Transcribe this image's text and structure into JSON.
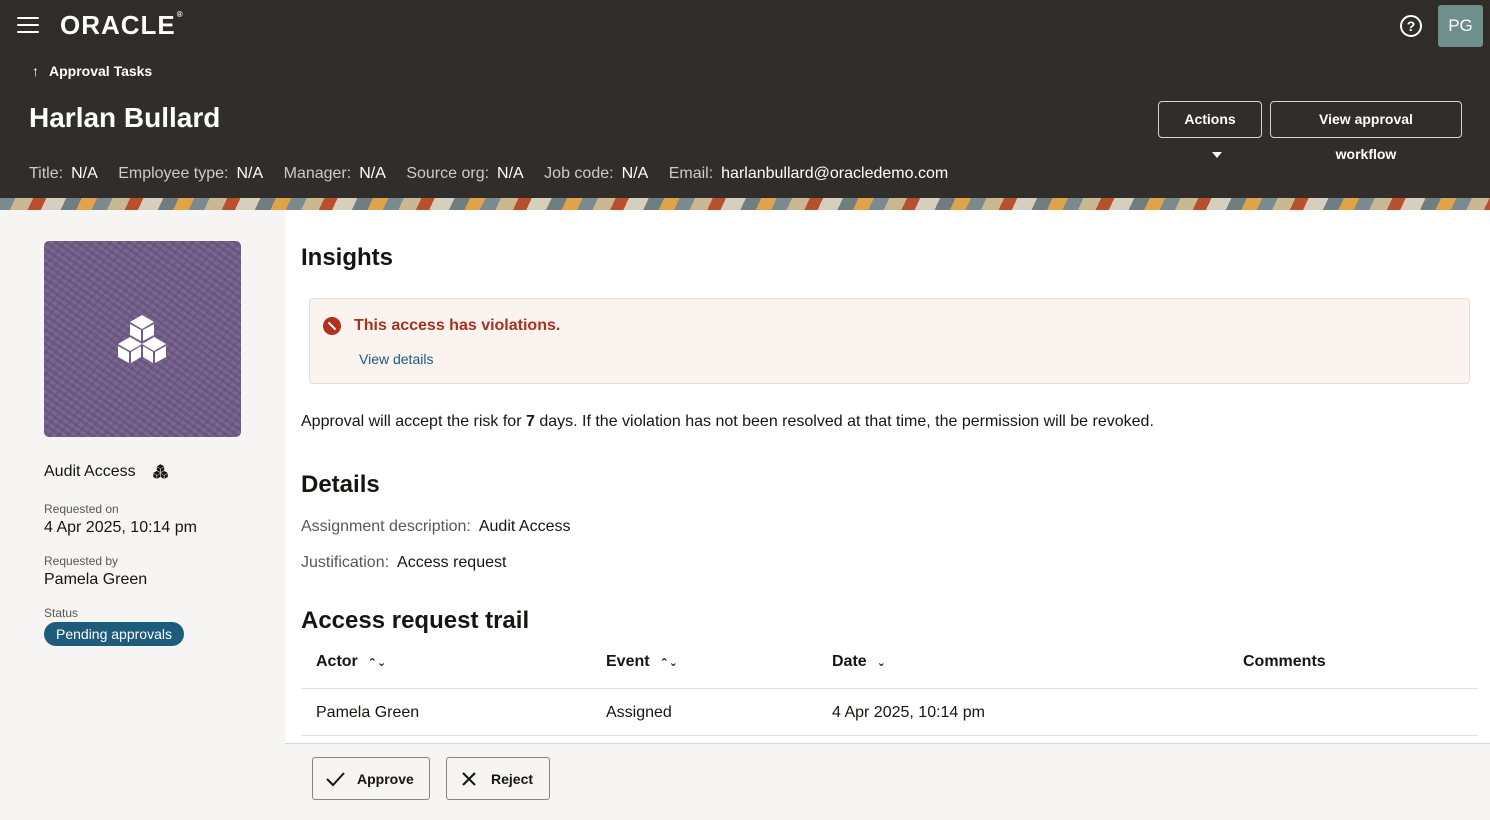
{
  "topbar": {
    "brand": "ORACLE",
    "user_initials": "PG",
    "colors": {
      "bar": "#2f2c29",
      "avatar": "#6e8f8c"
    },
    "icons": {
      "menu": "hamburger-menu-icon",
      "help": "help-circle-icon"
    }
  },
  "header": {
    "back_label": "Approval Tasks",
    "title": "Harlan Bullard",
    "actions_label": "Actions",
    "workflow_label": "View approval workflow",
    "meta": [
      {
        "key": "Title:",
        "value": "N/A"
      },
      {
        "key": "Employee type:",
        "value": "N/A"
      },
      {
        "key": "Manager:",
        "value": "N/A"
      },
      {
        "key": "Source org:",
        "value": "N/A"
      },
      {
        "key": "Job code:",
        "value": "N/A"
      },
      {
        "key": "Email:",
        "value": "harlanbullard@oracledemo.com"
      }
    ]
  },
  "sidebar": {
    "item_name": "Audit Access",
    "requested_on_label": "Requested on",
    "requested_on": "4 Apr 2025, 10:14 pm",
    "requested_by_label": "Requested by",
    "requested_by": "Pamela Green",
    "status_label": "Status",
    "status": "Pending approvals",
    "status_color": "#1f5b7a",
    "icon": "cubes-icon"
  },
  "main": {
    "insights_heading": "Insights",
    "alert_title": "This access has violations.",
    "alert_link": "View details",
    "alert_color": "#b3311c",
    "risk_before": "Approval will accept the risk for ",
    "risk_days": "7",
    "risk_after": " days. If the violation has not been resolved at that time, the permission will be revoked.",
    "details_heading": "Details",
    "assignment_label": "Assignment description:",
    "assignment_value": "Audit Access",
    "justification_label": "Justification:",
    "justification_value": "Access request",
    "trail_heading": "Access request trail",
    "columns": [
      "Actor",
      "Event",
      "Date",
      "Comments"
    ],
    "rows": [
      {
        "actor": "Pamela Green",
        "event": "Assigned",
        "date": "4 Apr 2025, 10:14 pm",
        "comments": ""
      }
    ]
  },
  "footer": {
    "approve_label": "Approve",
    "reject_label": "Reject"
  }
}
